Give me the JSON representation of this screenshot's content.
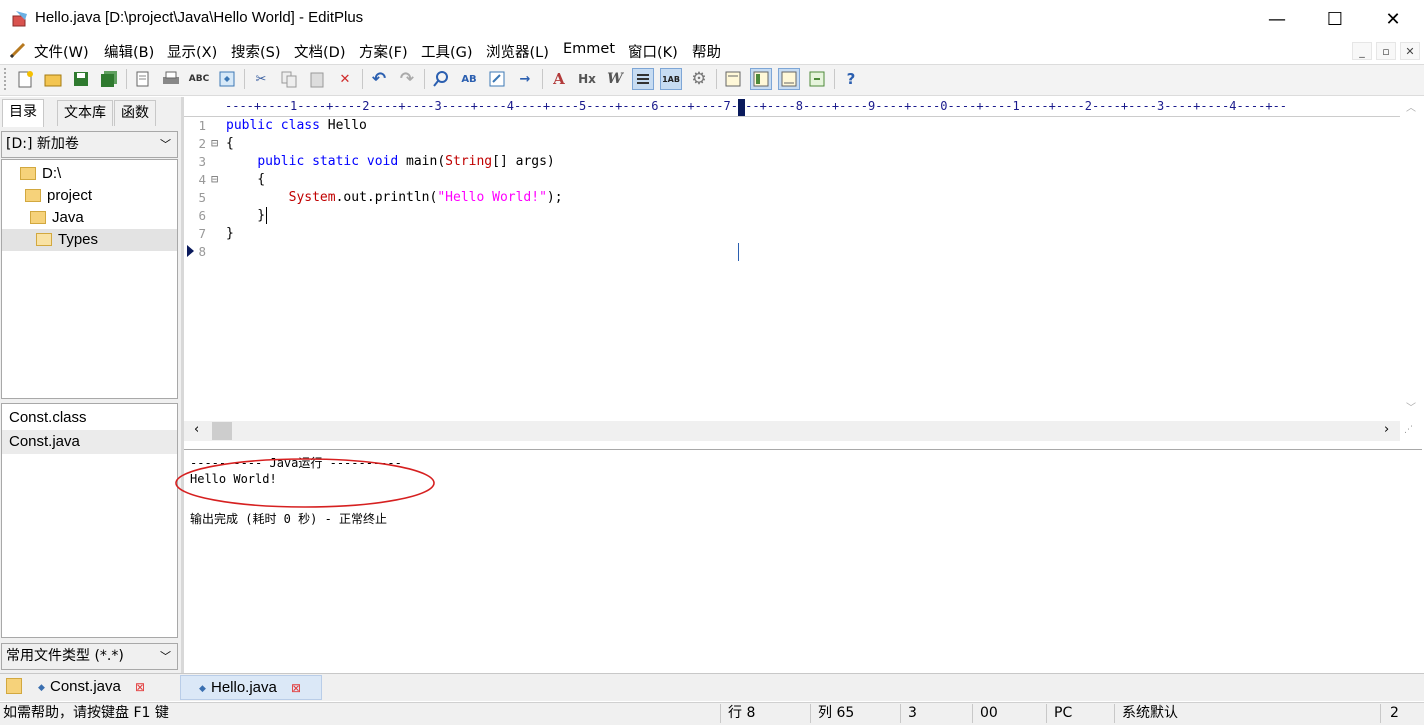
{
  "window": {
    "title": "Hello.java [D:\\project\\Java\\Hello World] - EditPlus",
    "minimize": "—",
    "maximize": "☐",
    "close": "✕"
  },
  "menu": [
    "文件(W)",
    "编辑(B)",
    "显示(X)",
    "搜索(S)",
    "文档(D)",
    "方案(F)",
    "工具(G)",
    "浏览器(L)",
    "Emmet",
    "窗口(K)",
    "帮助"
  ],
  "mdi_controls": [
    "_",
    "▫",
    "✕"
  ],
  "toolbar": {
    "icons": [
      "new-file-icon",
      "open-icon",
      "save-icon",
      "save-all-icon",
      "print-preview-icon",
      "print-icon",
      "spellcheck-icon",
      "browser-icon",
      "cut-icon",
      "copy-icon",
      "paste-icon",
      "delete-icon",
      "undo-icon",
      "redo-icon",
      "find-icon",
      "replace-icon",
      "goto-icon",
      "next-icon",
      "font-icon",
      "hex-icon",
      "word-wrap-icon",
      "line-number-icon",
      "column-icon",
      "settings-icon",
      "panel-icon",
      "output-icon",
      "tools-icon",
      "html-icon",
      "help-icon"
    ]
  },
  "left_panel": {
    "tabs": [
      "目录",
      "文本库",
      "函数"
    ],
    "drive": "[D:] 新加卷",
    "tree": [
      "D:\\",
      "project",
      "Java",
      "Types"
    ],
    "files": [
      "Const.class",
      "Const.java"
    ],
    "filter": "常用文件类型 (*.*)"
  },
  "ruler": "----+----1----+----2----+----3----+----4----+----5----+----6----+----7----+----8----+----9----+----0----+----1----+----2----+----3----+----4----+--",
  "editor": {
    "line_numbers": [
      "1",
      "2",
      "3",
      "4",
      "5",
      "6",
      "7",
      "8"
    ],
    "fold_markers": [
      "⊟",
      "⊟"
    ],
    "lines": [
      [
        {
          "t": "public class",
          "c": "kw"
        },
        {
          "t": " Hello",
          "c": ""
        }
      ],
      [
        {
          "t": "{",
          "c": ""
        }
      ],
      [
        {
          "t": "    ",
          "c": ""
        },
        {
          "t": "public static void",
          "c": "kw"
        },
        {
          "t": " main(",
          "c": ""
        },
        {
          "t": "String",
          "c": "ty"
        },
        {
          "t": "[] args)",
          "c": ""
        }
      ],
      [
        {
          "t": "    {",
          "c": ""
        }
      ],
      [
        {
          "t": "        ",
          "c": ""
        },
        {
          "t": "System",
          "c": "ty"
        },
        {
          "t": ".out.println(",
          "c": ""
        },
        {
          "t": "\"Hello World!\"",
          "c": "st"
        },
        {
          "t": ");",
          "c": ""
        }
      ],
      [
        {
          "t": "    }",
          "c": ""
        }
      ],
      [
        {
          "t": "}",
          "c": ""
        }
      ],
      [
        {
          "t": "",
          "c": ""
        }
      ]
    ]
  },
  "output": {
    "header": "---------- Java运行 ----------",
    "result": "Hello World!",
    "footer": "输出完成 (耗时 0 秒) - 正常终止"
  },
  "doc_tabs": [
    {
      "label": "Const.java",
      "close": "⊠"
    },
    {
      "label": "Hello.java",
      "close": "⊠"
    }
  ],
  "status": {
    "help": "如需帮助，请按键盘 F1 键",
    "line": "行 8",
    "col": "列 65",
    "sel": "3",
    "mode": "00",
    "eol": "PC",
    "encoding": "系统默认",
    "extra": "2"
  },
  "annotation_color": "#d62020"
}
